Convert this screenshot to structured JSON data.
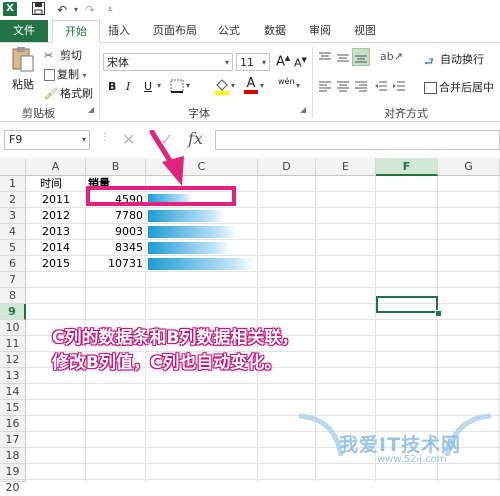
{
  "title_bar": {
    "app_icon": "X",
    "undo_icon": "undo-icon",
    "redo_icon": "redo-icon"
  },
  "tabs": [
    "文件",
    "开始",
    "插入",
    "页面布局",
    "公式",
    "数据",
    "审阅",
    "视图"
  ],
  "ribbon": {
    "clipboard": {
      "paste": "粘贴",
      "cut": "剪切",
      "copy": "复制",
      "format_painter": "格式刷",
      "group_label": "剪贴板"
    },
    "font": {
      "font_name": "宋体",
      "font_size": "11",
      "bold": "B",
      "italic": "I",
      "underline": "U",
      "font_color_glyph": "A",
      "font_grow": "A",
      "font_shrink": "A",
      "phonetic": "wén",
      "group_label": "字体"
    },
    "alignment": {
      "wrap_text": "自动换行",
      "merge_center": "合并后居中",
      "group_label": "对齐方式"
    }
  },
  "formula_bar": {
    "name_box": "F9",
    "cancel": "✕",
    "enter": "✓",
    "fx": "fx",
    "value": ""
  },
  "columns": [
    "A",
    "B",
    "C",
    "D",
    "E",
    "F",
    "G"
  ],
  "rows": [
    "1",
    "2",
    "3",
    "4",
    "5",
    "6",
    "7",
    "8",
    "9",
    "10",
    "11",
    "12",
    "13",
    "14",
    "15",
    "16",
    "17",
    "18",
    "19",
    "20"
  ],
  "table": {
    "headers": [
      "时间",
      "销量"
    ],
    "data": [
      {
        "year": "2011",
        "sales": "4590",
        "bar_fraction": 0.4277
      },
      {
        "year": "2012",
        "sales": "7780",
        "bar_fraction": 0.725
      },
      {
        "year": "2013",
        "sales": "9003",
        "bar_fraction": 0.839
      },
      {
        "year": "2014",
        "sales": "8345",
        "bar_fraction": 0.7777
      },
      {
        "year": "2015",
        "sales": "10731",
        "bar_fraction": 1.0
      }
    ]
  },
  "selected_cell": "F9",
  "annotation": {
    "line1": "C列的数据条和B列数据相关联，",
    "line2": "修改B列值，C列也自动变化。"
  },
  "watermark": {
    "text": "我爱IT技术网",
    "url": "www.52ij.com"
  },
  "colors": {
    "excel_green": "#217346",
    "annotation_pink": "#e0237d",
    "bar_blue": "#1e9ad8"
  }
}
